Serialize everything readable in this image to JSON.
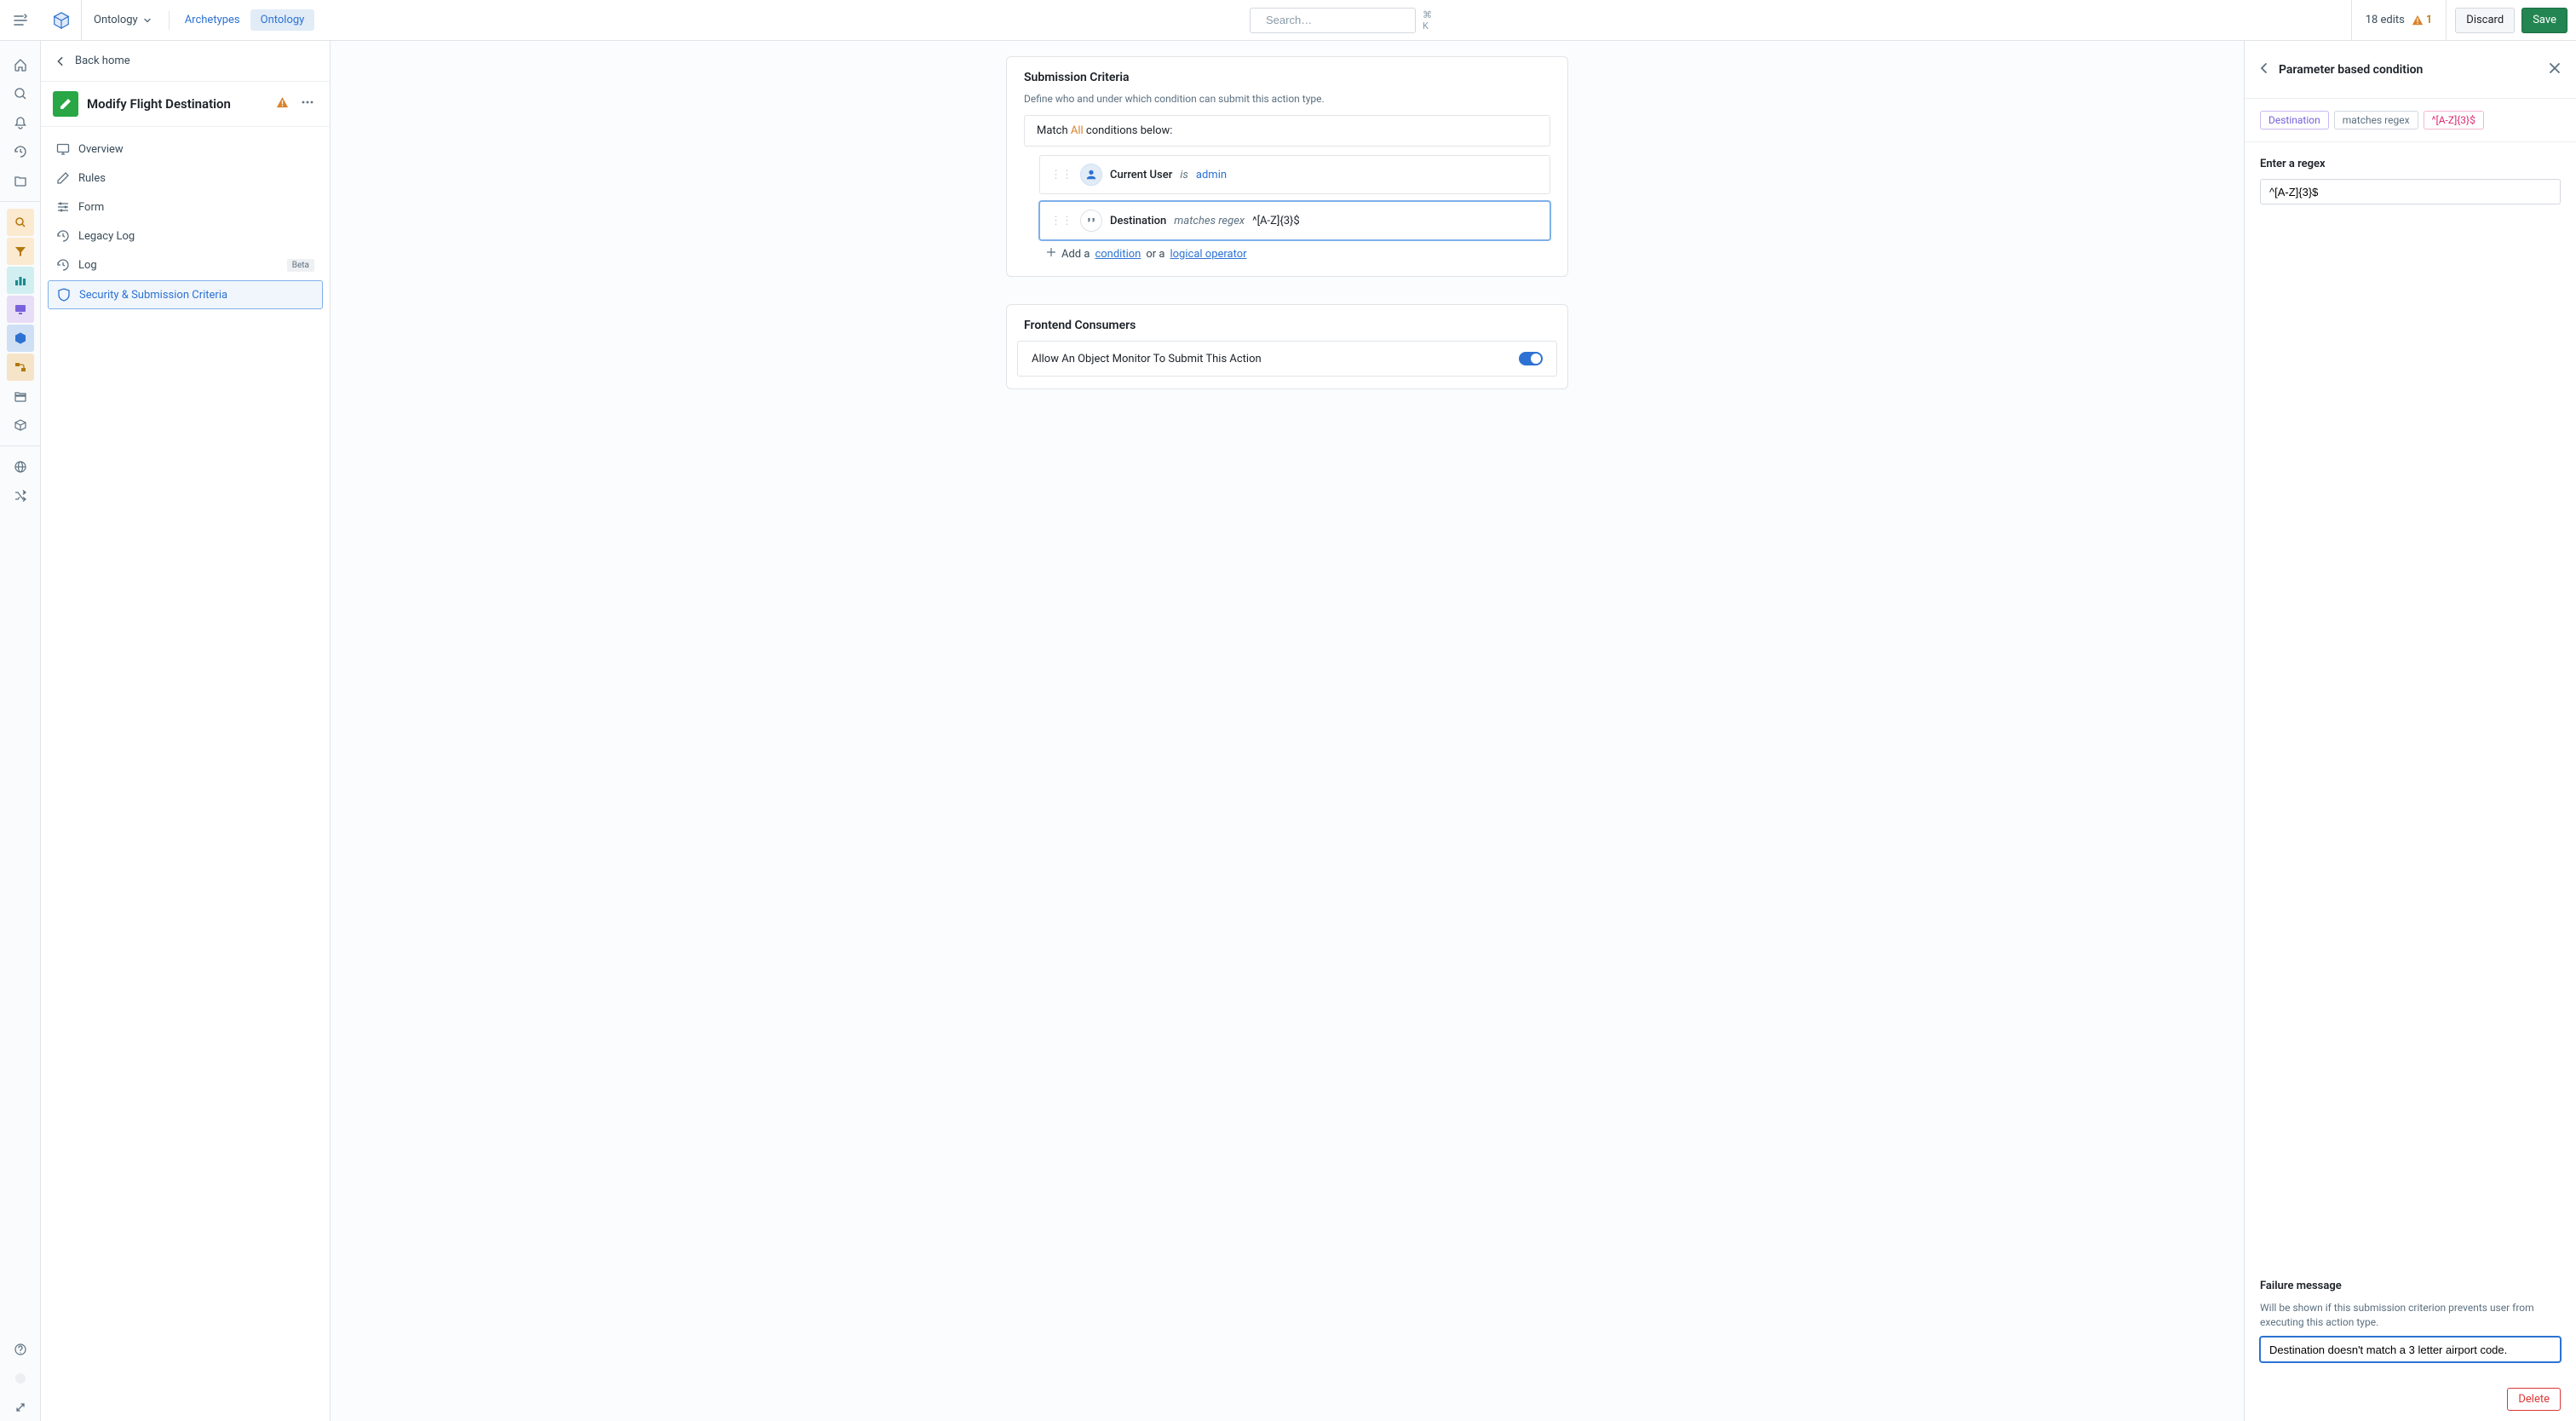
{
  "topbar": {
    "workspace": "Ontology",
    "tabs": [
      "Archetypes",
      "Ontology"
    ],
    "active_tab": 1,
    "search_placeholder": "Search…",
    "search_kbd": "⌘ K",
    "edits_label": "18 edits",
    "warn_count": "1",
    "discard": "Discard",
    "save": "Save"
  },
  "leftPanel": {
    "back": "Back home",
    "title": "Modify Flight Destination",
    "nav": {
      "overview": "Overview",
      "rules": "Rules",
      "form": "Form",
      "legacyLog": "Legacy Log",
      "log": "Log",
      "logBadge": "Beta",
      "security": "Security & Submission Criteria"
    }
  },
  "center": {
    "card1": {
      "title": "Submission Criteria",
      "desc": "Define who and under which condition can submit this action type.",
      "match_pre": "Match ",
      "match_all": "All",
      "match_post": " conditions below:",
      "cond1": {
        "field": "Current User",
        "op": "is",
        "val": "admin"
      },
      "cond2": {
        "field": "Destination",
        "op": "matches regex",
        "val": "^[A-Z]{3}$"
      },
      "add_pre": "Add a ",
      "add_link1": "condition",
      "add_mid": " or a ",
      "add_link2": "logical operator"
    },
    "card2": {
      "title": "Frontend Consumers",
      "toggleLabel": "Allow An Object Monitor To Submit This Action"
    }
  },
  "rightPanel": {
    "title": "Parameter based condition",
    "chips": [
      "Destination",
      "matches regex",
      "^[A-Z]{3}$"
    ],
    "regexLabel": "Enter a regex",
    "regexValue": "^[A-Z]{3}$",
    "failLabel": "Failure message",
    "failDesc": "Will be shown if this submission criterion prevents user from executing this action type.",
    "failValue": "Destination doesn't match a 3 letter airport code.",
    "delete": "Delete"
  }
}
